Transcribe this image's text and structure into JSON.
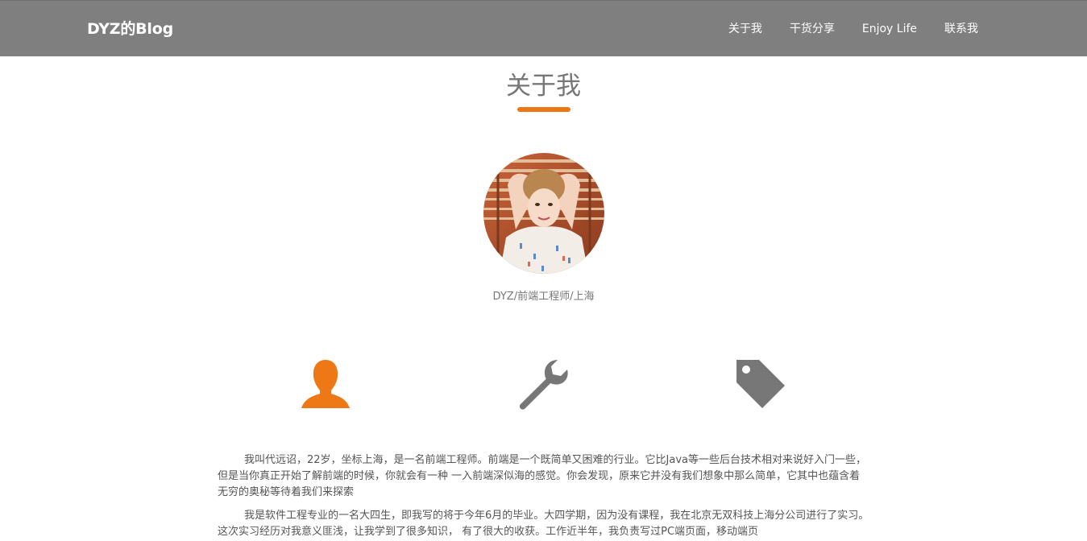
{
  "header": {
    "brand": "DYZ的Blog",
    "nav": [
      "关于我",
      "干货分享",
      "Enjoy Life",
      "联系我"
    ]
  },
  "about": {
    "title": "关于我",
    "subtitle": "DYZ/前端工程师/上海"
  },
  "features": [
    {
      "icon": "user-icon",
      "color": "#ee7716"
    },
    {
      "icon": "wrench-icon",
      "color": "#777777"
    },
    {
      "icon": "tag-icon",
      "color": "#777777"
    }
  ],
  "paragraphs": [
    "我叫代远诏，22岁，坐标上海，是一名前端工程师。前端是一个既简单又困难的行业。它比Java等一些后台技术相对来说好入门一些，但是当你真正开始了解前端的时候，你就会有一种 一入前端深似海的感觉。你会发现，原来它并没有我们想象中那么简单，它其中也蕴含着无穷的奥秘等待着我们来探索",
    "我是软件工程专业的一名大四生，即我写的将于今年6月的毕业。大四学期，因为没有课程，我在北京无双科技上海分公司进行了实习。这次实习经历对我意义匪浅，让我学到了很多知识， 有了很大的收获。工作近半年，我负责写过PC端页面，移动端页"
  ],
  "colors": {
    "header_bg": "#7f7f7f",
    "accent": "#ee7716",
    "text": "#555555"
  }
}
